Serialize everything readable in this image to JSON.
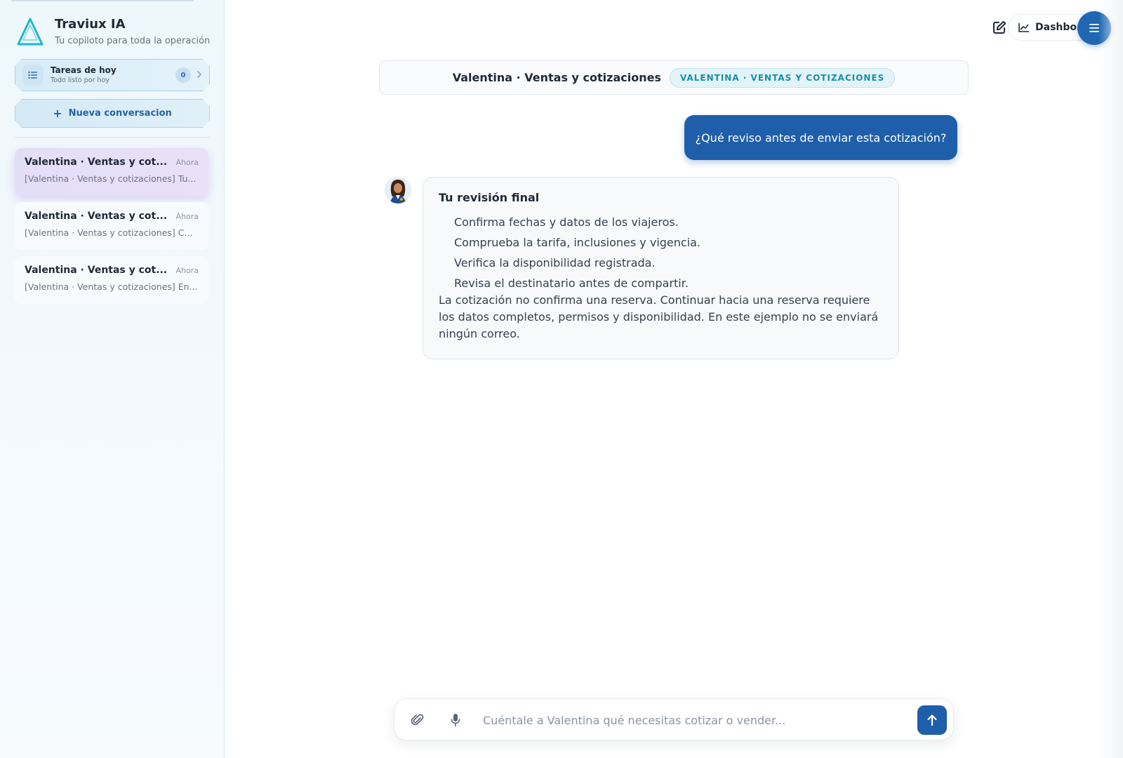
{
  "brand": {
    "title": "Traviux IA",
    "subtitle": "Tu copiloto para toda la operación"
  },
  "tasks": {
    "title": "Tareas de hoy",
    "subtitle": "Todo listo por hoy",
    "count": "0"
  },
  "new_conversation": {
    "label": "Nueva conversacion"
  },
  "conversations": [
    {
      "title": "Valentina · Ventas y cot...",
      "time": "Ahora",
      "preview": "[Valentina · Ventas y cotizaciones] Tu...",
      "active": true
    },
    {
      "title": "Valentina · Ventas y cot...",
      "time": "Ahora",
      "preview": "[Valentina · Ventas y cotizaciones] C...",
      "active": false
    },
    {
      "title": "Valentina · Ventas y cot...",
      "time": "Ahora",
      "preview": "[Valentina · Ventas y cotizaciones] En...",
      "active": false
    }
  ],
  "topbar": {
    "dashboard_label": "Dashboa"
  },
  "chat": {
    "header_title": "Valentina · Ventas y cotizaciones",
    "header_badge": "VALENTINA · VENTAS Y COTIZACIONES",
    "user_message": "¿Qué reviso antes de enviar esta cotización?",
    "assistant": {
      "title": "Tu revisión final",
      "items": [
        "Confirma fechas y datos de los viajeros.",
        "Comprueba la tarifa, inclusiones y vigencia.",
        "Verifica la disponibilidad registrada.",
        "Revisa el destinatario antes de compartir."
      ],
      "body": "La cotización no confirma una reserva. Continuar hacia una reserva requiere los datos completos, permisos y disponibilidad. En este ejemplo no se enviará ningún correo."
    }
  },
  "composer": {
    "placeholder": "Cuéntale a Valentina qué necesitas cotizar o vender...",
    "value": ""
  },
  "colors": {
    "primary": "#1f5ea9",
    "accent_teal": "#1a8ea8",
    "active_item": "#e3def8"
  },
  "icons": {
    "logo": "triangle-logo-icon",
    "tasks": "checklist-icon",
    "chevron": "chevron-right-icon",
    "plus": "plus-icon",
    "edit": "edit-icon",
    "dashboard": "chart-line-icon",
    "menu": "hamburger-menu-icon",
    "attach": "paperclip-icon",
    "mic": "microphone-icon",
    "send": "arrow-up-icon"
  }
}
